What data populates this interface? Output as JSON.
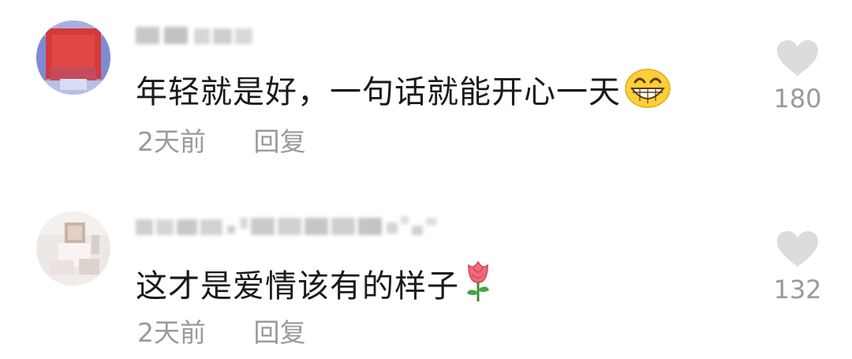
{
  "comments": [
    {
      "text": "年轻就是好，一句话就能开心一天",
      "emoji_icon": "grinning-face-icon",
      "time": "2天前",
      "reply_label": "回复",
      "likes": "180"
    },
    {
      "text": "这才是爱情该有的样子",
      "emoji_icon": "rose-icon",
      "time": "2天前",
      "reply_label": "回复",
      "likes": "132"
    }
  ],
  "colors": {
    "text": "#1a1a1a",
    "meta": "#9a9a9a",
    "heart": "#dcdcdc",
    "background": "#ffffff"
  }
}
